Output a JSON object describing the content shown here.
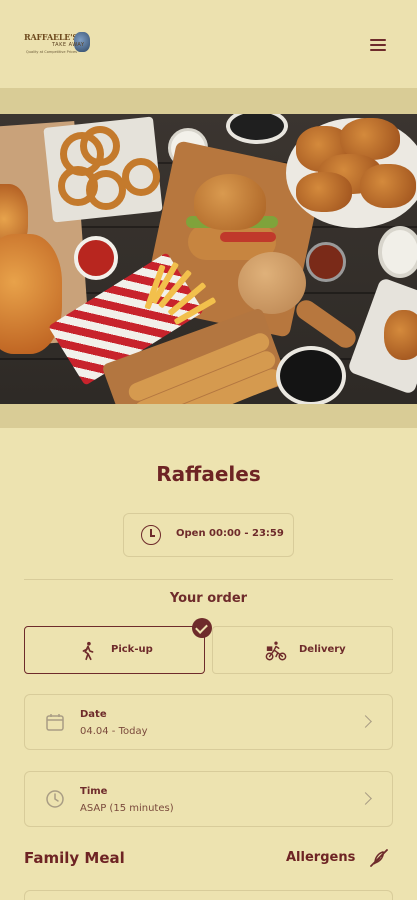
{
  "header": {
    "logo_line1": "RAFFAELE'S",
    "logo_line2": "TAKE AWAY",
    "logo_line3": "Quality at Competitive Prices",
    "menu_icon": "hamburger-menu-icon"
  },
  "restaurant": {
    "name": "Raffaeles",
    "hours": "Open 00:00 - 23:59",
    "hours_icon": "clock-icon"
  },
  "order": {
    "heading": "Your order",
    "options": [
      {
        "label": "Pick-up",
        "icon": "walking-person-icon",
        "selected": true
      },
      {
        "label": "Delivery",
        "icon": "bicycle-courier-icon",
        "selected": false
      }
    ],
    "date": {
      "label": "Date",
      "value": "04.04 - Today",
      "icon": "calendar-icon"
    },
    "time": {
      "label": "Time",
      "value": "ASAP (15 minutes)",
      "icon": "clock-icon"
    }
  },
  "menu": {
    "category": "Family Meal",
    "allergens_label": "Allergens",
    "allergens_icon": "no-wheat-icon"
  },
  "colors": {
    "background": "#ede3b0",
    "accent": "#6e2b2b",
    "border": "#d8cc9a"
  }
}
